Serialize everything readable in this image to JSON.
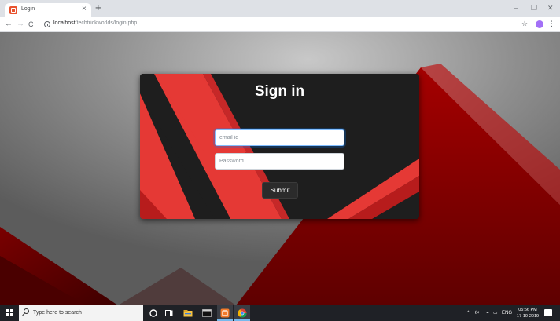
{
  "browser": {
    "tab_title": "Login",
    "tab_close": "×",
    "new_tab": "+",
    "url_host": "localhost",
    "url_path": "/techtrickworlds/login.php",
    "window_controls": {
      "minimize": "–",
      "restore": "❐",
      "close": "✕"
    },
    "nav": {
      "back": "←",
      "forward": "→",
      "reload": "C"
    },
    "icons": {
      "favicon": "page-favicon-icon",
      "info": "info-icon",
      "bookmark": "star-icon",
      "profile": "profile-icon",
      "menu": "kebab-menu-icon"
    },
    "star": "☆",
    "menu": "⋮"
  },
  "login": {
    "title": "Sign in",
    "email": {
      "value": "",
      "placeholder": "email id"
    },
    "password": {
      "value": "",
      "placeholder": "Password"
    },
    "submit_label": "Submit"
  },
  "taskbar": {
    "search_placeholder": "Type here to search",
    "tray": {
      "chevron": "^",
      "volume": "ℓ×",
      "network": "⌁",
      "battery": "▭",
      "language": "ENG"
    },
    "time": "05:56 PM",
    "date": "17-10-2019"
  },
  "colors": {
    "card_red": "#e53935",
    "card_dark": "#1e1e1e",
    "bg_gray": "#7a7a7a",
    "bg_red": "#8a0000",
    "taskbar": "#1f2126",
    "tab_strip": "#dee1e6"
  }
}
